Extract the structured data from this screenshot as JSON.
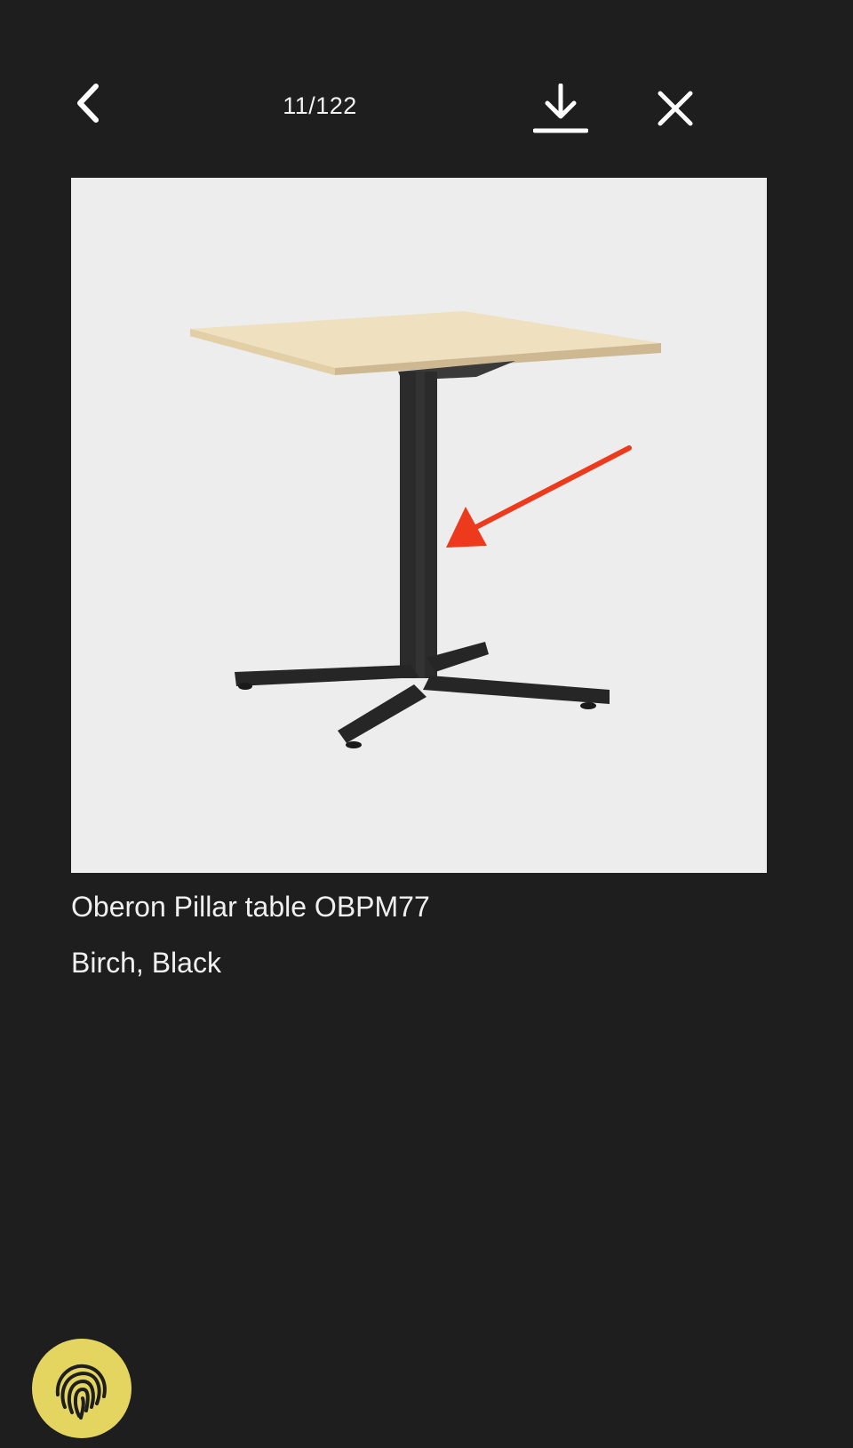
{
  "viewer": {
    "counter": "11/122",
    "icons": {
      "back": "chevron-left-icon",
      "download": "download-icon",
      "close": "close-icon",
      "fab": "fingerprint-icon"
    }
  },
  "product": {
    "name": "Oberon Pillar table OBPM77",
    "finish": "Birch, Black"
  },
  "colors": {
    "background": "#1e1e1e",
    "photo_background": "#ededed",
    "annotation_arrow": "#ee3a1c",
    "fab": "#e4d560"
  }
}
